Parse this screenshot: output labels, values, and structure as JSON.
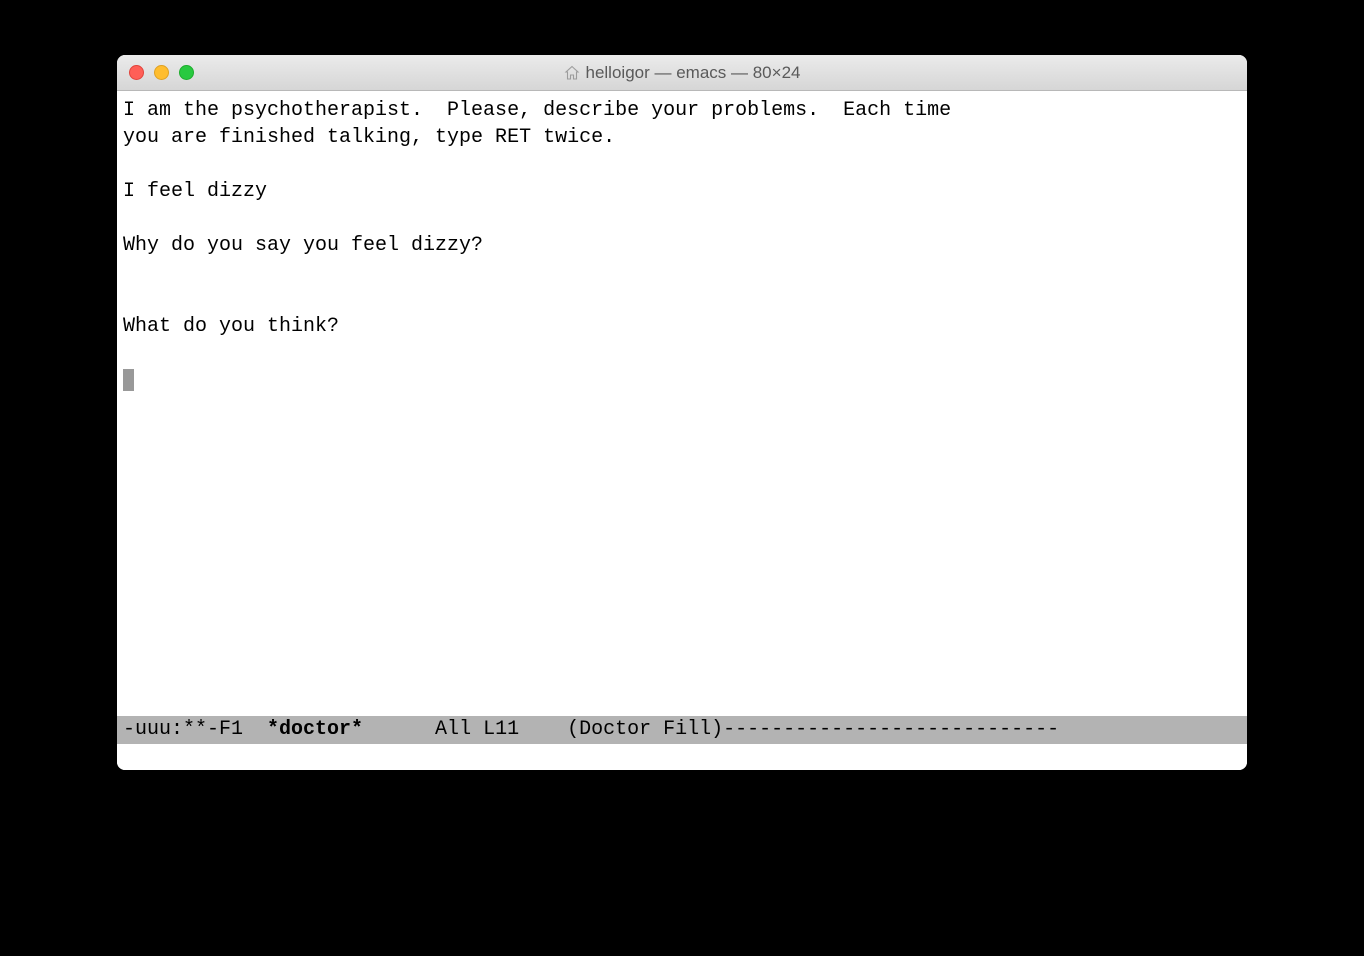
{
  "window": {
    "title": "helloigor — emacs — 80×24"
  },
  "buffer": {
    "lines": [
      "I am the psychotherapist.  Please, describe your problems.  Each time",
      "you are finished talking, type RET twice.",
      "",
      "I feel dizzy",
      "",
      "Why do you say you feel dizzy?",
      "",
      "",
      "What do you think?",
      ""
    ]
  },
  "modeline": {
    "left": "-uuu:**-F1  ",
    "buffer_name": "*doctor*",
    "middle": "      All L11    (Doctor Fill)",
    "fill": "----------------------------"
  }
}
